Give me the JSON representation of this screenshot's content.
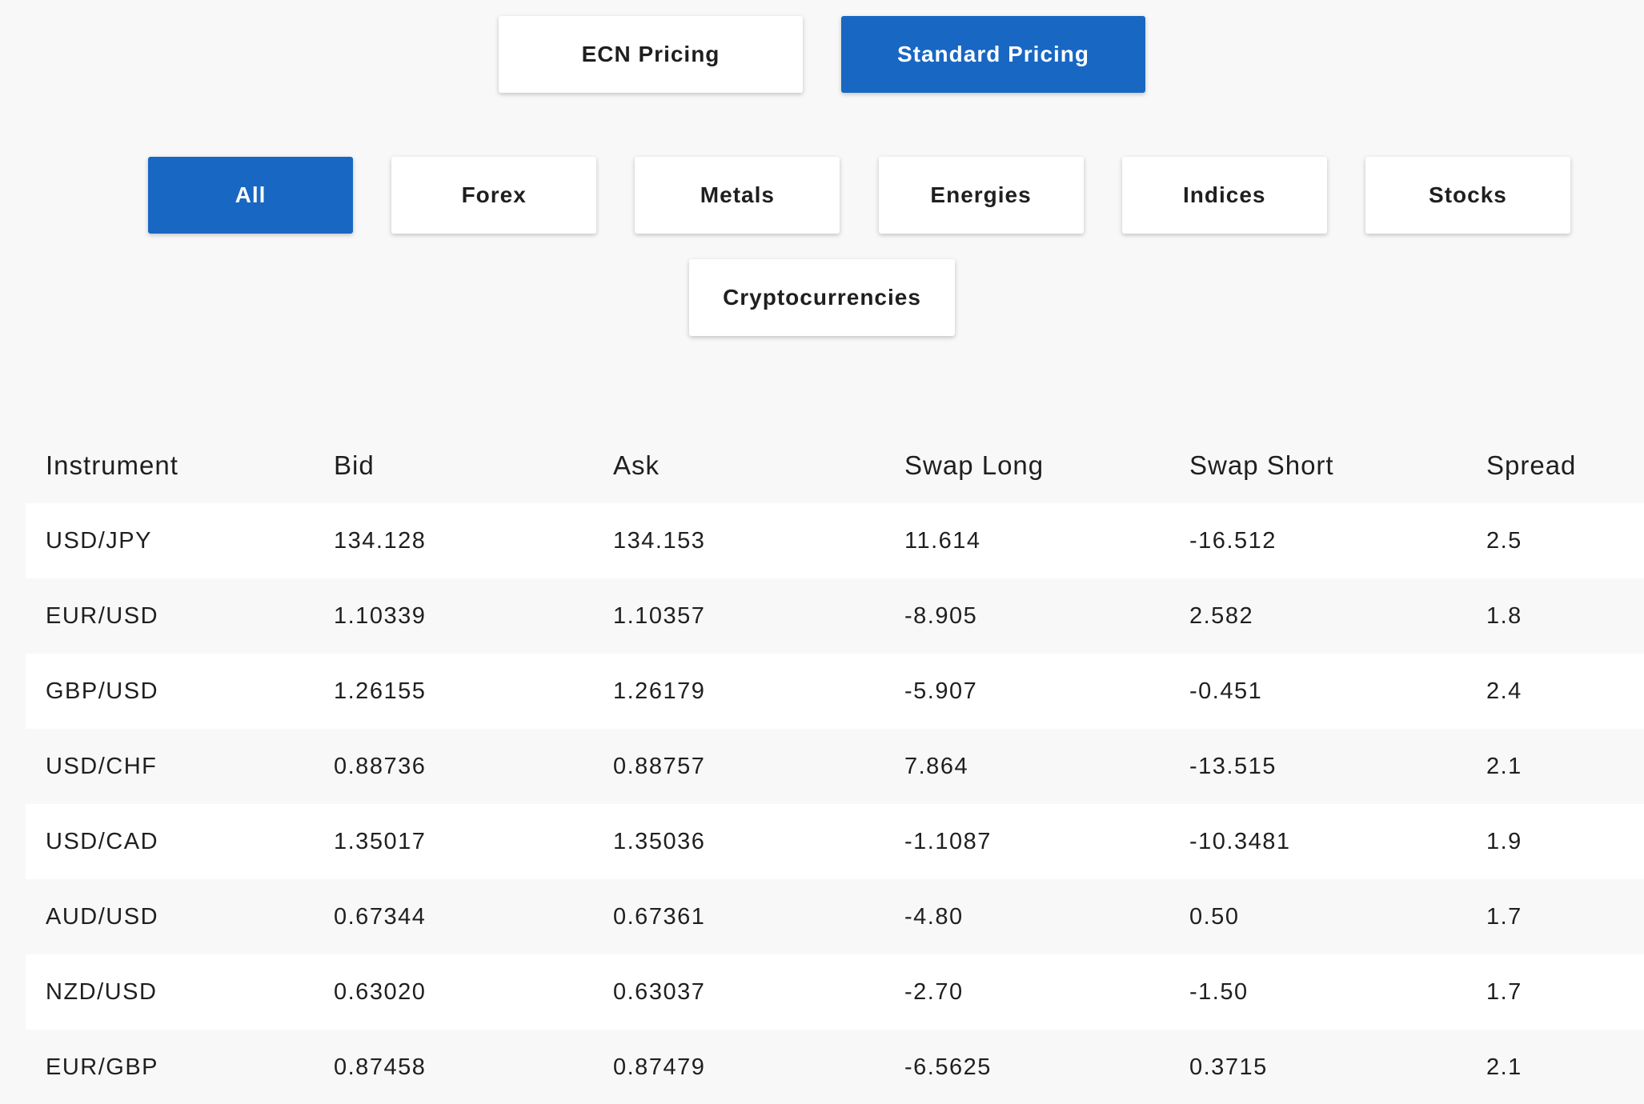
{
  "pricing_toggle": {
    "ecn_label": "ECN Pricing",
    "standard_label": "Standard Pricing",
    "active": "Standard Pricing"
  },
  "categories": {
    "all": "All",
    "forex": "Forex",
    "metals": "Metals",
    "energies": "Energies",
    "indices": "Indices",
    "stocks": "Stocks",
    "cryptocurrencies": "Cryptocurrencies",
    "active": "All"
  },
  "colors": {
    "accent": "#1867c3",
    "background": "#f8f8f8",
    "row_alt": "#ffffff"
  },
  "table": {
    "headers": {
      "instrument": "Instrument",
      "bid": "Bid",
      "ask": "Ask",
      "swap_long": "Swap Long",
      "swap_short": "Swap Short",
      "spread": "Spread"
    },
    "rows": [
      {
        "instrument": "USD/JPY",
        "bid": "134.128",
        "ask": "134.153",
        "swap_long": "11.614",
        "swap_short": "-16.512",
        "spread": "2.5"
      },
      {
        "instrument": "EUR/USD",
        "bid": "1.10339",
        "ask": "1.10357",
        "swap_long": "-8.905",
        "swap_short": "2.582",
        "spread": "1.8"
      },
      {
        "instrument": "GBP/USD",
        "bid": "1.26155",
        "ask": "1.26179",
        "swap_long": "-5.907",
        "swap_short": "-0.451",
        "spread": "2.4"
      },
      {
        "instrument": "USD/CHF",
        "bid": "0.88736",
        "ask": "0.88757",
        "swap_long": "7.864",
        "swap_short": "-13.515",
        "spread": "2.1"
      },
      {
        "instrument": "USD/CAD",
        "bid": "1.35017",
        "ask": "1.35036",
        "swap_long": "-1.1087",
        "swap_short": "-10.3481",
        "spread": "1.9"
      },
      {
        "instrument": "AUD/USD",
        "bid": "0.67344",
        "ask": "0.67361",
        "swap_long": "-4.80",
        "swap_short": "0.50",
        "spread": "1.7"
      },
      {
        "instrument": "NZD/USD",
        "bid": "0.63020",
        "ask": "0.63037",
        "swap_long": "-2.70",
        "swap_short": "-1.50",
        "spread": "1.7"
      },
      {
        "instrument": "EUR/GBP",
        "bid": "0.87458",
        "ask": "0.87479",
        "swap_long": "-6.5625",
        "swap_short": "0.3715",
        "spread": "2.1"
      }
    ]
  }
}
